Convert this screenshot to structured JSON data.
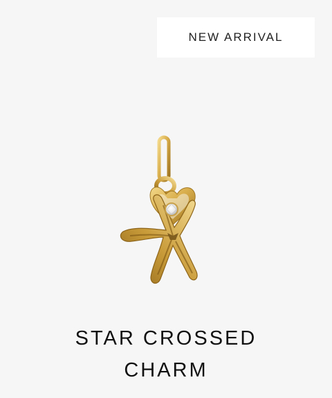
{
  "badge": {
    "label": "NEW ARRIVAL"
  },
  "product": {
    "title_line1": "STAR CROSSED",
    "title_line2": "CHARM",
    "image_icon": "star-heart-charm-image",
    "colors": {
      "gold": "#d8ad4c",
      "background": "#f6f6f6"
    }
  }
}
